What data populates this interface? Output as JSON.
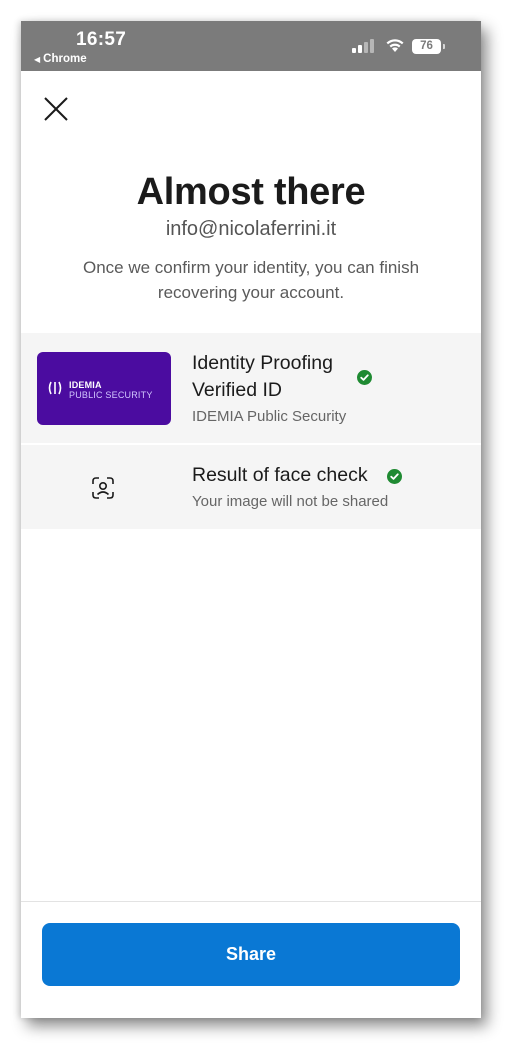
{
  "status_bar": {
    "time": "16:57",
    "back_app": "Chrome",
    "battery_level": "76",
    "icons": [
      "signal-icon",
      "wifi-icon",
      "battery-icon"
    ]
  },
  "header": {
    "close_icon": "close-icon",
    "title": "Almost there",
    "email": "info@nicolaferrini.it",
    "subtitle": "Once we confirm your identity, you can finish recovering your account."
  },
  "credentials": [
    {
      "logo_text_line1": "IDEMIA",
      "logo_text_line2": "PUBLIC SECURITY",
      "title_line1": "Identity Proofing",
      "title_line2": "Verified ID",
      "subtitle": "IDEMIA Public Security",
      "verified": true
    },
    {
      "icon": "face-scan-icon",
      "title": "Result of face check",
      "subtitle": "Your image will not be shared",
      "verified": true
    }
  ],
  "footer": {
    "share_label": "Share"
  },
  "colors": {
    "accent": "#0a78d4",
    "verified_green": "#1f8a32",
    "idemia_purple": "#4b0ca0",
    "status_bar_bg": "#7b7b7b"
  }
}
